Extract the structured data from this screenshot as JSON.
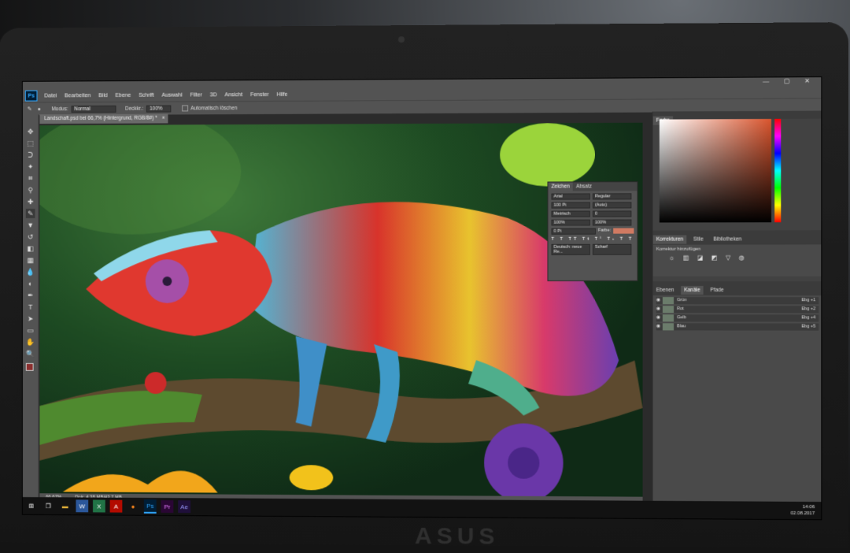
{
  "app": {
    "logo": "Ps",
    "window_buttons": "— ▢ ✕"
  },
  "menu": [
    "Datei",
    "Bearbeiten",
    "Bild",
    "Ebene",
    "Schrift",
    "Auswahl",
    "Filter",
    "3D",
    "Ansicht",
    "Fenster",
    "Hilfe"
  ],
  "options_bar": {
    "mode_label": "Modus:",
    "mode_value": "Normal",
    "opacity_label": "Deckkr.:",
    "opacity_value": "100%",
    "auto_erase_label": "Automatisch löschen"
  },
  "document_tab": {
    "title": "Landschaft.psd bei 66,7% (Hintergrund, RGB/8#) *",
    "close": "×"
  },
  "status_bar": {
    "zoom": "66,67%",
    "doc_size": "Dok: 4,38 MB/43,7 MB"
  },
  "right_panels": {
    "color_tab": "Farbe",
    "adjust_tabs": [
      "Korrekturen",
      "Stile",
      "Bibliotheken"
    ],
    "adjust_title": "Korrektur hinzufügen",
    "layer_tabs": [
      "Ebenen",
      "Kanäle",
      "Pfade"
    ],
    "layers": [
      {
        "name": "Grün",
        "value": "Ebg +1"
      },
      {
        "name": "Rot",
        "value": "Ebg +2"
      },
      {
        "name": "Gelb",
        "value": "Ebg +4"
      },
      {
        "name": "Blau",
        "value": "Ebg +5"
      }
    ]
  },
  "character_panel": {
    "tabs": [
      "Zeichen",
      "Absatz"
    ],
    "font_family": "Arial",
    "font_style": "Regular",
    "size": "100 Pt",
    "leading": "(Auto)",
    "kerning": "Metrisch",
    "tracking": "0",
    "vertical_scale": "100%",
    "horizontal_scale": "100%",
    "baseline": "0 Pt",
    "color_label": "Farbe:",
    "language": "Deutsch: neue Re...",
    "aa": "Scharf",
    "text_color": "#d07a62"
  },
  "taskbar": {
    "time": "14:06",
    "date": "02.08.2017"
  },
  "device_brand": "ASUS",
  "colors": {
    "ps_bg": "#535353",
    "panel_bg": "#424242",
    "accent": "#31a8ff"
  }
}
